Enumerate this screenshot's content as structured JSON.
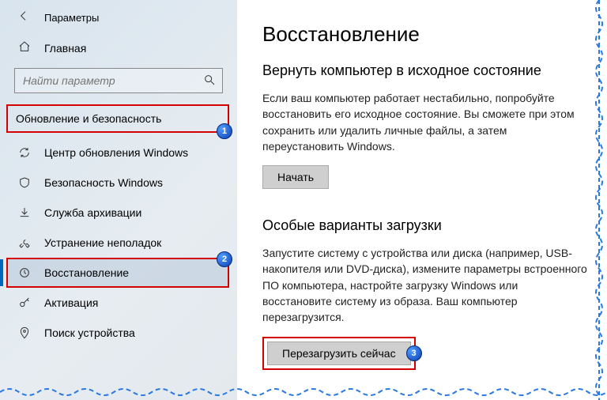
{
  "titlebar": {
    "title": "Параметры"
  },
  "home": {
    "label": "Главная"
  },
  "search": {
    "placeholder": "Найти параметр"
  },
  "category": {
    "label": "Обновление и безопасность"
  },
  "sidebar": {
    "items": [
      {
        "label": "Центр обновления Windows"
      },
      {
        "label": "Безопасность Windows"
      },
      {
        "label": "Служба архивации"
      },
      {
        "label": "Устранение неполадок"
      },
      {
        "label": "Восстановление"
      },
      {
        "label": "Активация"
      },
      {
        "label": "Поиск устройства"
      }
    ]
  },
  "badges": {
    "b1": "1",
    "b2": "2",
    "b3": "3"
  },
  "page": {
    "title": "Восстановление",
    "reset": {
      "title": "Вернуть компьютер в исходное состояние",
      "text": "Если ваш компьютер работает нестабильно, попробуйте восстановить его исходное состояние. Вы сможете при этом сохранить или удалить личные файлы, а затем переустановить Windows.",
      "button": "Начать"
    },
    "advanced": {
      "title": "Особые варианты загрузки",
      "text": "Запустите систему с устройства или диска (например, USB-накопителя или DVD-диска), измените параметры встроенного ПО компьютера, настройте загрузку Windows или восстановите систему из образа. Ваш компьютер перезагрузится.",
      "button": "Перезагрузить сейчас"
    }
  }
}
